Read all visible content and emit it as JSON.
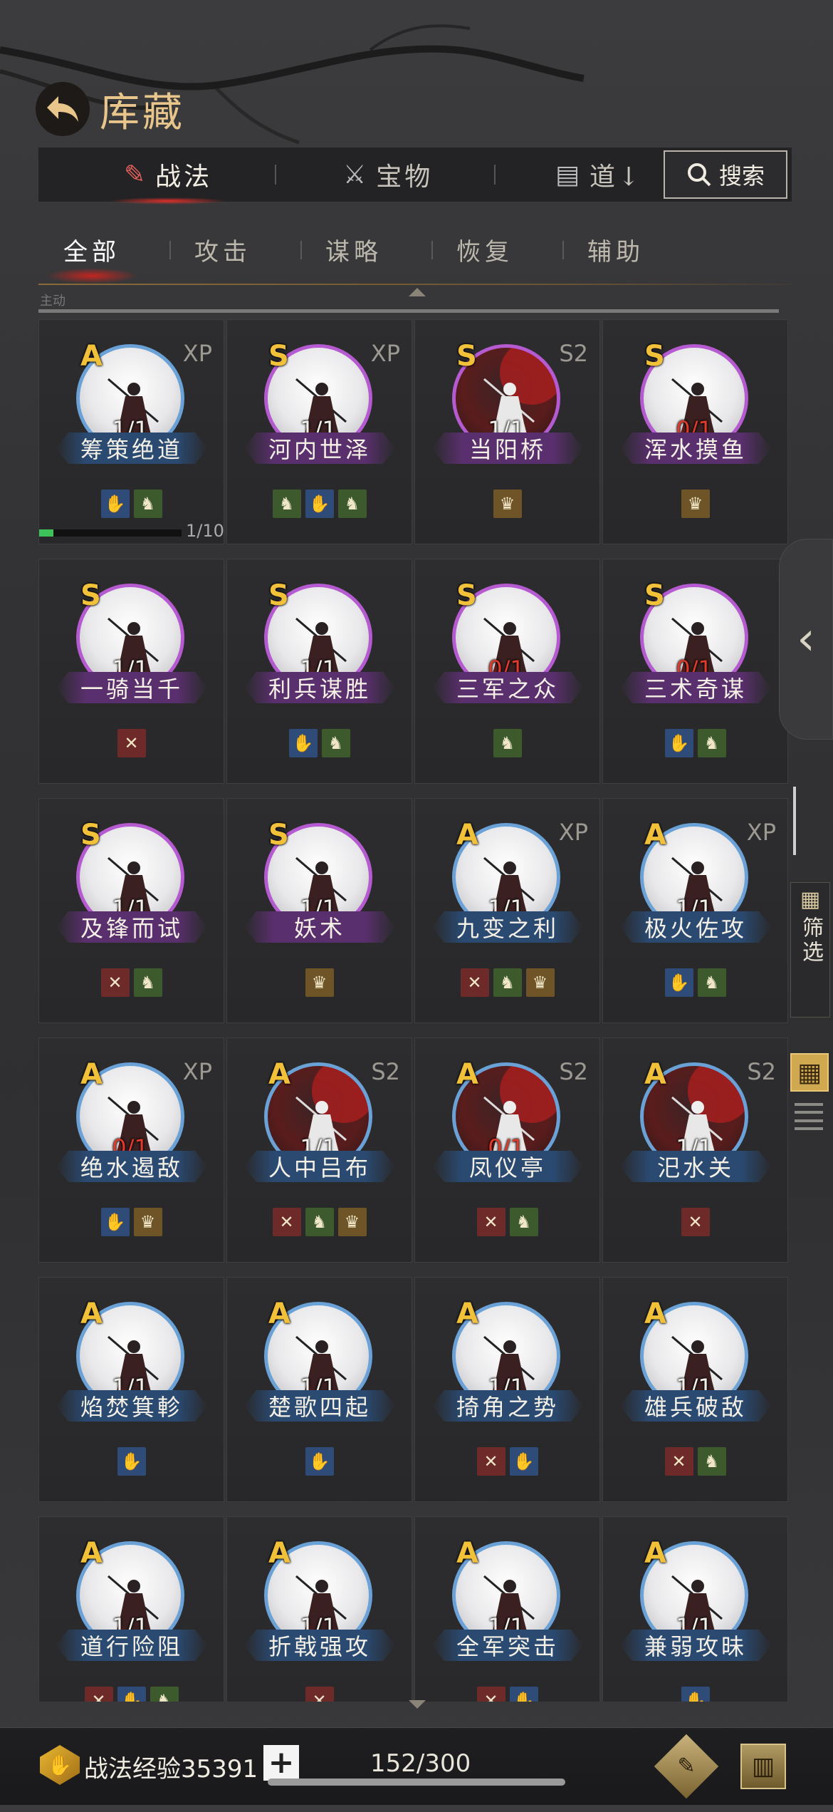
{
  "header": {
    "title": "库藏"
  },
  "top_tabs": [
    {
      "label": "战法",
      "icon": "scroll-icon",
      "active": true
    },
    {
      "label": "宝物",
      "icon": "weapon-icon",
      "active": false
    },
    {
      "label": "道↓",
      "icon": "item-icon",
      "active": false
    }
  ],
  "search": {
    "label": "搜索"
  },
  "sub_tabs": [
    "全部",
    "攻击",
    "谋略",
    "恢复",
    "辅助"
  ],
  "partial_row_label": "主动",
  "skills": [
    {
      "grade": "A",
      "tag": "XP",
      "count": "1/1",
      "name": "筹策绝道",
      "frame": "blue",
      "art": "light",
      "icons": [
        "blue",
        "green"
      ],
      "progress": "1/10"
    },
    {
      "grade": "S",
      "tag": "XP",
      "count": "1/1",
      "name": "河内世泽",
      "frame": "purple",
      "art": "light",
      "icons": [
        "green",
        "blue",
        "green"
      ]
    },
    {
      "grade": "S",
      "tag": "S2",
      "count": "1/1",
      "name": "当阳桥",
      "frame": "purple",
      "art": "red",
      "icons": [
        "gold"
      ]
    },
    {
      "grade": "S",
      "tag": "",
      "count": "0/1",
      "name": "浑水摸鱼",
      "frame": "purple",
      "art": "light",
      "icons": [
        "gold"
      ]
    },
    {
      "grade": "S",
      "tag": "",
      "count": "1/1",
      "name": "一骑当千",
      "frame": "purple",
      "art": "light",
      "icons": [
        "red"
      ]
    },
    {
      "grade": "S",
      "tag": "",
      "count": "1/1",
      "name": "利兵谋胜",
      "frame": "purple",
      "art": "light",
      "icons": [
        "blue",
        "green"
      ]
    },
    {
      "grade": "S",
      "tag": "",
      "count": "0/1",
      "name": "三军之众",
      "frame": "purple",
      "art": "light",
      "icons": [
        "green"
      ]
    },
    {
      "grade": "S",
      "tag": "",
      "count": "0/1",
      "name": "三术奇谋",
      "frame": "purple",
      "art": "light",
      "icons": [
        "blue",
        "green"
      ]
    },
    {
      "grade": "S",
      "tag": "",
      "count": "1/1",
      "name": "及锋而试",
      "frame": "purple",
      "art": "light",
      "icons": [
        "red",
        "green"
      ]
    },
    {
      "grade": "S",
      "tag": "",
      "count": "1/1",
      "name": "妖术",
      "frame": "purple",
      "art": "light",
      "icons": [
        "gold"
      ]
    },
    {
      "grade": "A",
      "tag": "XP",
      "count": "1/1",
      "name": "九变之利",
      "frame": "blue",
      "art": "light",
      "icons": [
        "red",
        "green",
        "gold"
      ]
    },
    {
      "grade": "A",
      "tag": "XP",
      "count": "1/1",
      "name": "极火佐攻",
      "frame": "blue",
      "art": "light",
      "icons": [
        "blue",
        "green"
      ]
    },
    {
      "grade": "A",
      "tag": "XP",
      "count": "0/1",
      "name": "绝水遏敌",
      "frame": "blue",
      "art": "light",
      "icons": [
        "blue",
        "gold"
      ]
    },
    {
      "grade": "A",
      "tag": "S2",
      "count": "1/1",
      "name": "人中吕布",
      "frame": "blue",
      "art": "red",
      "icons": [
        "red",
        "green",
        "gold"
      ]
    },
    {
      "grade": "A",
      "tag": "S2",
      "count": "0/1",
      "name": "凤仪亭",
      "frame": "blue",
      "art": "red",
      "icons": [
        "red",
        "green"
      ]
    },
    {
      "grade": "A",
      "tag": "S2",
      "count": "1/1",
      "name": "汜水关",
      "frame": "blue",
      "art": "red",
      "icons": [
        "red"
      ]
    },
    {
      "grade": "A",
      "tag": "",
      "count": "1/1",
      "name": "焰焚箕軫",
      "frame": "blue",
      "art": "light",
      "icons": [
        "blue"
      ]
    },
    {
      "grade": "A",
      "tag": "",
      "count": "1/1",
      "name": "楚歌四起",
      "frame": "blue",
      "art": "light",
      "icons": [
        "blue"
      ]
    },
    {
      "grade": "A",
      "tag": "",
      "count": "1/1",
      "name": "掎角之势",
      "frame": "blue",
      "art": "light",
      "icons": [
        "red",
        "blue"
      ]
    },
    {
      "grade": "A",
      "tag": "",
      "count": "1/1",
      "name": "雄兵破敌",
      "frame": "blue",
      "art": "light",
      "icons": [
        "red",
        "green"
      ]
    },
    {
      "grade": "A",
      "tag": "",
      "count": "1/1",
      "name": "道行险阻",
      "frame": "blue",
      "art": "light",
      "icons": [
        "red",
        "blue",
        "green"
      ]
    },
    {
      "grade": "A",
      "tag": "",
      "count": "1/1",
      "name": "折戟强攻",
      "frame": "blue",
      "art": "light",
      "icons": [
        "red"
      ]
    },
    {
      "grade": "A",
      "tag": "",
      "count": "1/1",
      "name": "全军突击",
      "frame": "blue",
      "art": "light",
      "icons": [
        "red",
        "blue"
      ]
    },
    {
      "grade": "A",
      "tag": "",
      "count": "1/1",
      "name": "兼弱攻昧",
      "frame": "blue",
      "art": "light",
      "icons": [
        "blue"
      ]
    }
  ],
  "sidebar": {
    "filter_label": "筛选"
  },
  "bottom": {
    "exp_label": "战法经验35391",
    "capacity": "152/300"
  },
  "colors": {
    "accent_gold": "#e8c58a",
    "grade_gold": "#f2c13a",
    "frame_s": "#b55ad0",
    "frame_a": "#6aa2d8",
    "count_zero": "#e23a2a"
  }
}
